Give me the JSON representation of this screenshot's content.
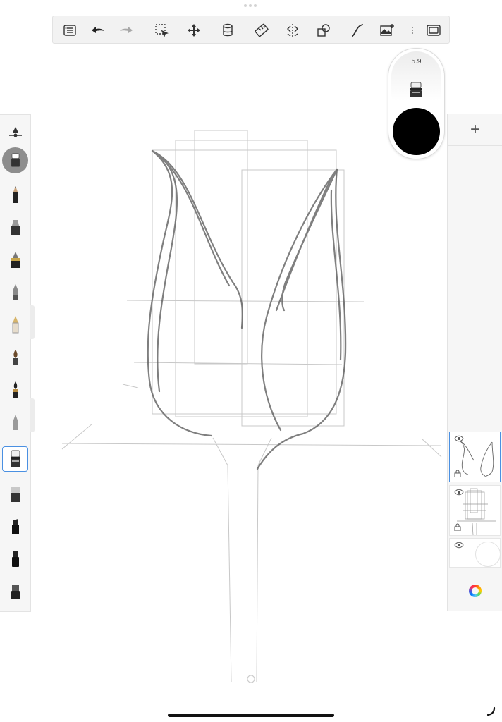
{
  "toolbar": {
    "items": [
      {
        "name": "menu-icon"
      },
      {
        "name": "undo-icon"
      },
      {
        "name": "redo-icon",
        "disabled": true
      },
      {
        "name": "selection-icon"
      },
      {
        "name": "transform-icon"
      },
      {
        "name": "fill-icon"
      },
      {
        "name": "ruler-icon"
      },
      {
        "name": "symmetry-icon"
      },
      {
        "name": "shapes-icon"
      },
      {
        "name": "curve-icon"
      },
      {
        "name": "add-image-icon"
      },
      {
        "name": "fullscreen-icon"
      }
    ]
  },
  "brush_puck": {
    "size": "5.9",
    "color": "#000000"
  },
  "brushes": {
    "selected_index": 9,
    "items": [
      "pencil-icon",
      "marker-icon",
      "ink-pen-icon",
      "airbrush-icon",
      "fountain-pen-icon",
      "paintbrush-icon",
      "ink-brush-icon",
      "soft-brush-icon",
      "eraser-brush-icon",
      "hard-eraser-icon",
      "chisel-marker-icon",
      "block-marker-icon",
      "flat-marker-icon"
    ]
  },
  "layers": {
    "add_label": "+",
    "items": [
      {
        "name": "layer-sketch",
        "selected": true
      },
      {
        "name": "layer-guides",
        "selected": false
      },
      {
        "name": "layer-background",
        "selected": false
      }
    ]
  },
  "colors": {
    "accent": "#4a90e2",
    "panel": "#f6f6f6",
    "ink": "#000000"
  }
}
